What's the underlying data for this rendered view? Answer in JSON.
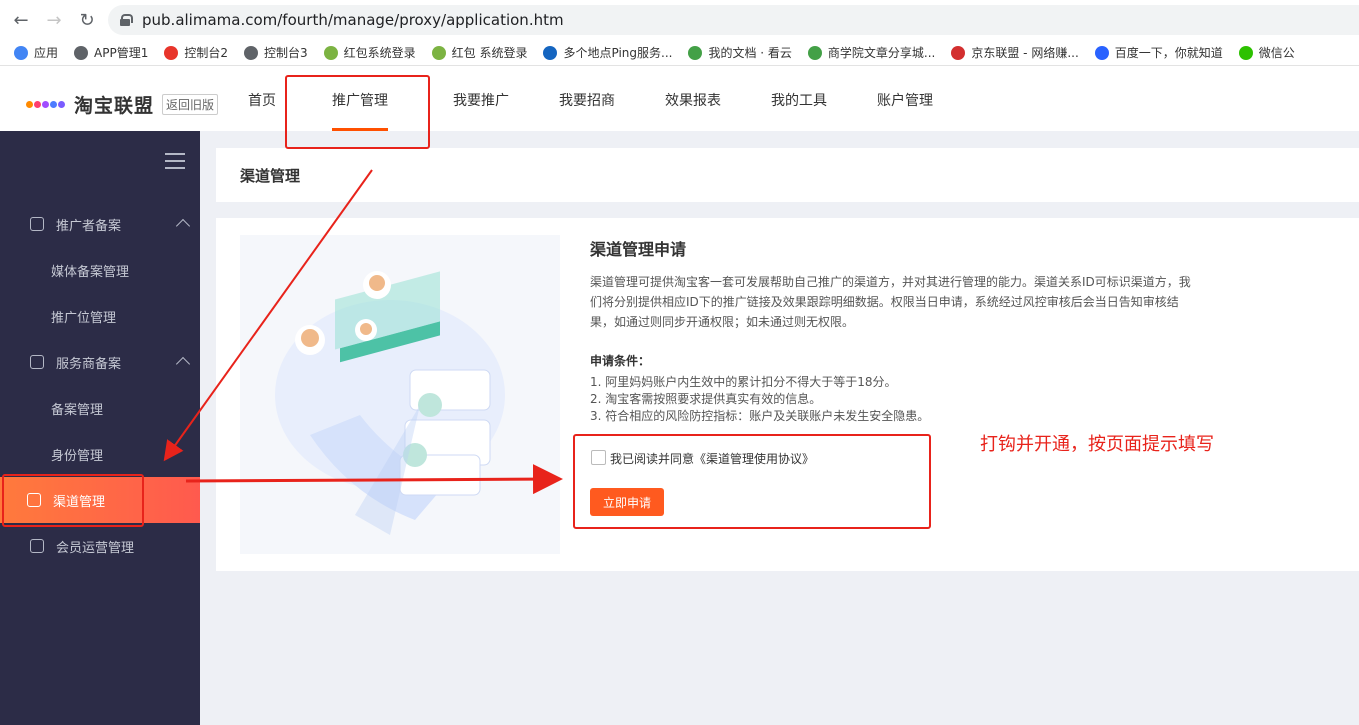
{
  "browser": {
    "url": "pub.alimama.com/fourth/manage/proxy/application.htm",
    "bookmarks": [
      {
        "label": "应用",
        "color": "#4285f4"
      },
      {
        "label": "APP管理1",
        "color": "#5f6368"
      },
      {
        "label": "控制台2",
        "color": "#e8352b"
      },
      {
        "label": "控制台3",
        "color": "#5f6368"
      },
      {
        "label": "红包系统登录",
        "color": "#7cb342"
      },
      {
        "label": "红包 系统登录",
        "color": "#7cb342"
      },
      {
        "label": "多个地点Ping服务...",
        "color": "#1565c0"
      },
      {
        "label": "我的文档 · 看云",
        "color": "#43a047"
      },
      {
        "label": "商学院文章分享城...",
        "color": "#43a047"
      },
      {
        "label": "京东联盟 - 网络赚...",
        "color": "#d32f2f"
      },
      {
        "label": "百度一下，你就知道",
        "color": "#2962ff"
      },
      {
        "label": "微信公",
        "color": "#2dc100"
      }
    ]
  },
  "header": {
    "logo_text": "淘宝联盟",
    "old_version": "返回旧版",
    "nav": [
      "首页",
      "推广管理",
      "我要推广",
      "我要招商",
      "效果报表",
      "我的工具",
      "账户管理"
    ]
  },
  "sidebar": {
    "items": [
      {
        "label": "推广者备案",
        "type": "group"
      },
      {
        "label": "媒体备案管理",
        "type": "sub"
      },
      {
        "label": "推广位管理",
        "type": "sub"
      },
      {
        "label": "服务商备案",
        "type": "group"
      },
      {
        "label": "备案管理",
        "type": "sub"
      },
      {
        "label": "身份管理",
        "type": "sub"
      },
      {
        "label": "渠道管理",
        "type": "active"
      },
      {
        "label": "会员运营管理",
        "type": "group-plain"
      }
    ]
  },
  "page": {
    "title": "渠道管理",
    "app_title": "渠道管理申请",
    "description": "渠道管理可提供淘宝客一套可发展帮助自己推广的渠道方，并对其进行管理的能力。渠道关系ID可标识渠道方，我们将分别提供相应ID下的推广链接及效果跟踪明细数据。权限当日申请，系统经过风控审核后会当日告知审核结果，如通过则同步开通权限；如未通过则无权限。",
    "conditions_title": "申请条件：",
    "conditions": [
      "1. 阿里妈妈账户内生效中的累计扣分不得大于等于18分。",
      "2. 淘宝客需按照要求提供真实有效的信息。",
      "3. 符合相应的风险防控指标：账户及关联账户未发生安全隐患。"
    ],
    "agree_text": "我已阅读并同意《渠道管理使用协议》",
    "apply_button": "立即申请"
  },
  "annotation": {
    "text": "打钩并开通，按页面提示填写",
    "color": "#e8231b"
  }
}
